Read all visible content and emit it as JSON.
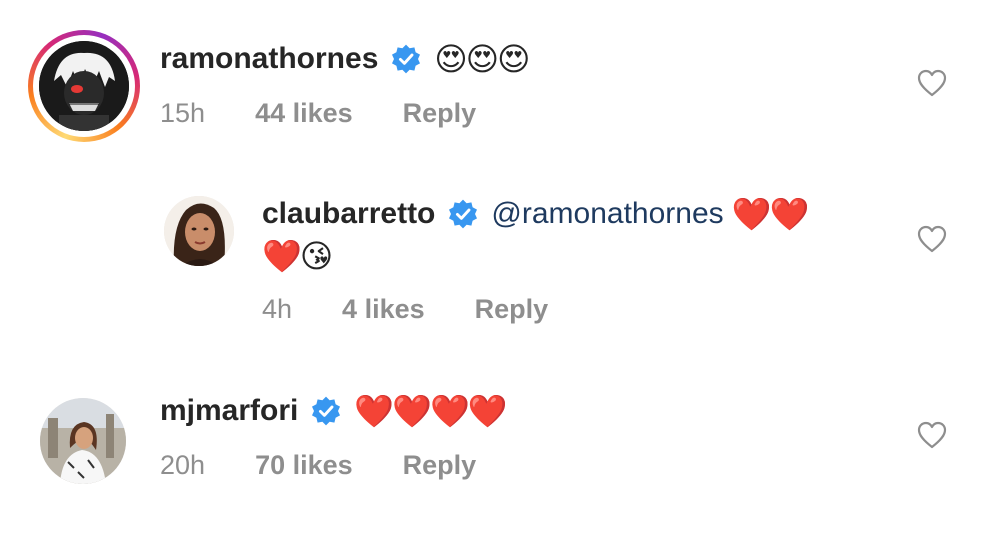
{
  "comments": [
    {
      "username": "ramonathornes",
      "verified": true,
      "text": "😍😍😍",
      "time": "15h",
      "likes": "44 likes",
      "reply": "Reply"
    },
    {
      "username": "claubarretto",
      "verified": true,
      "mention": "@ramonathornes",
      "text": "❤️❤️",
      "text_line2": "❤️😘",
      "time": "4h",
      "likes": "4 likes",
      "reply": "Reply"
    },
    {
      "username": "mjmarfori",
      "verified": true,
      "text": "❤️❤️❤️❤️",
      "time": "20h",
      "likes": "70 likes",
      "reply": "Reply"
    }
  ],
  "icons": {
    "verified_badge": "verified-badge-icon",
    "like": "heart-outline-icon"
  },
  "colors": {
    "verified_blue": "#3897f0",
    "meta_gray": "#8e8e8e",
    "mention": "#1e3a5f"
  }
}
